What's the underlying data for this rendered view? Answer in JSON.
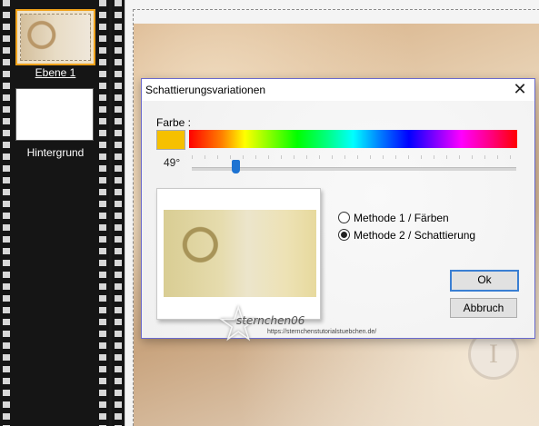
{
  "layers": [
    {
      "label": "Ebene 1",
      "selected": true
    },
    {
      "label": "Hintergrund",
      "selected": false
    }
  ],
  "dialog": {
    "title": "Schattierungsvariationen",
    "close_glyph": "✕",
    "color_label": "Farbe :",
    "selected_color": "#f6c000",
    "hue_degree_text": "49°",
    "hue_value": 49,
    "hue_max": 360,
    "methods": [
      {
        "label": "Methode 1 / Färben",
        "checked": false
      },
      {
        "label": "Methode 2 / Schattierung",
        "checked": true
      }
    ],
    "ok_label": "Ok",
    "cancel_label": "Abbruch"
  },
  "watermark": {
    "signature": "sternchen06",
    "url": "https://sternchenstutorialstuebchen.de/"
  },
  "colors": {
    "selection_border": "#f0a21a",
    "dialog_border": "#6a6acd",
    "slider_thumb": "#1e73d2",
    "default_button_border": "#3a7fd3"
  },
  "icons": {
    "close": "close-icon",
    "watermark_star": "star-icon"
  }
}
